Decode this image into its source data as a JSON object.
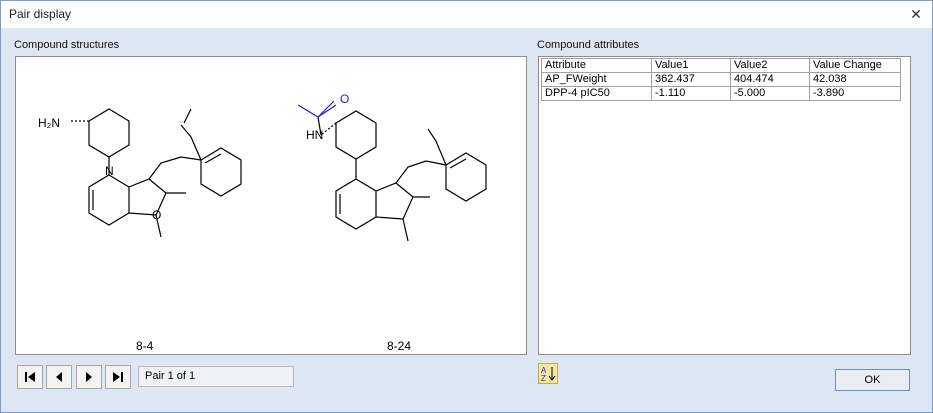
{
  "window": {
    "title": "Pair display",
    "close_icon": "close-icon"
  },
  "structures": {
    "label": "Compound structures",
    "compounds": [
      {
        "id": "8-4",
        "name": "8-4"
      },
      {
        "id": "8-24",
        "name": "8-24"
      }
    ],
    "atoms": {
      "h2n": "H₂N",
      "hn": "HN",
      "n": "N",
      "o": "O"
    },
    "highlight_color": "#1f1fd6"
  },
  "navigation": {
    "first_icon": "first-page-icon",
    "prev_icon": "previous-icon",
    "next_icon": "next-icon",
    "last_icon": "last-page-icon",
    "pair_text": "Pair 1 of 1"
  },
  "attributes": {
    "label": "Compound attributes",
    "columns": [
      "Attribute",
      "Value1",
      "Value2",
      "Value Change"
    ],
    "rows": [
      [
        "AP_FWeight",
        "362.437",
        "404.474",
        "42.038"
      ],
      [
        "DPP-4 pIC50",
        "-1.110",
        "-5.000",
        "-3.890"
      ]
    ],
    "sort_icon": "sort-az-icon"
  },
  "buttons": {
    "ok": "OK"
  }
}
